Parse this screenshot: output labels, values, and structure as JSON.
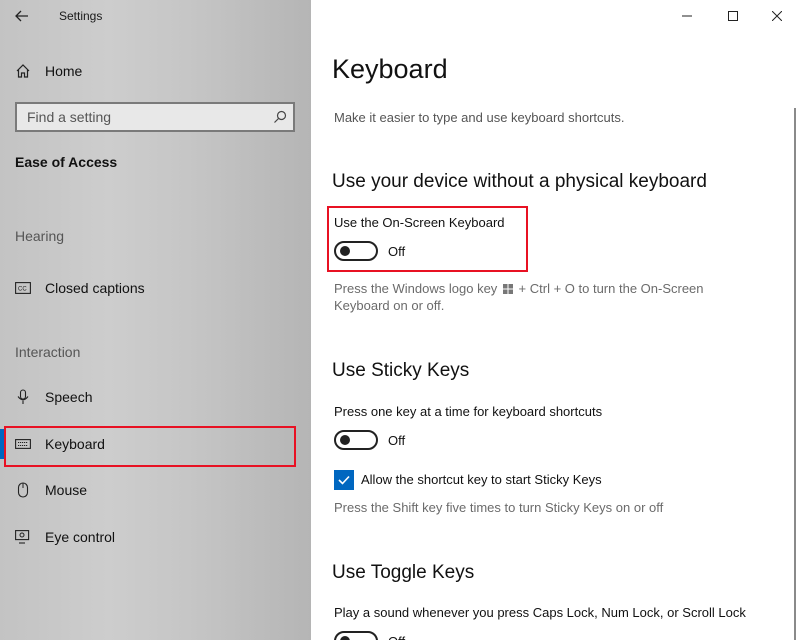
{
  "window": {
    "title": "Settings",
    "controls": {
      "minimize": "minimize",
      "maximize": "maximize",
      "close": "close"
    }
  },
  "sidebar": {
    "home_label": "Home",
    "search_placeholder": "Find a setting",
    "section_title": "Ease of Access",
    "groups": {
      "hearing": "Hearing",
      "interaction": "Interaction"
    },
    "items": {
      "closed_captions": "Closed captions",
      "speech": "Speech",
      "keyboard": "Keyboard",
      "mouse": "Mouse",
      "eye_control": "Eye control"
    },
    "selected": "Keyboard"
  },
  "main": {
    "title": "Keyboard",
    "subtitle": "Make it easier to type and use keyboard shortcuts.",
    "osk": {
      "heading": "Use your device without a physical keyboard",
      "label": "Use the On-Screen Keyboard",
      "state": "Off",
      "desc_before_icon": "Press the Windows logo key",
      "desc_after_icon": "+ Ctrl + O to turn the On-Screen",
      "desc_line2": "Keyboard on or off."
    },
    "sticky": {
      "heading": "Use Sticky Keys",
      "label": "Press one key at a time for keyboard shortcuts",
      "state": "Off",
      "checkbox_label": "Allow the shortcut key to start Sticky Keys",
      "checkbox_checked": true,
      "desc": "Press the Shift key five times to turn Sticky Keys on or off"
    },
    "toggle_keys": {
      "heading": "Use Toggle Keys",
      "label": "Play a sound whenever you press Caps Lock, Num Lock, or Scroll Lock",
      "state": "Off"
    }
  },
  "colors": {
    "accent": "#0067c0",
    "highlight": "#e81123"
  }
}
